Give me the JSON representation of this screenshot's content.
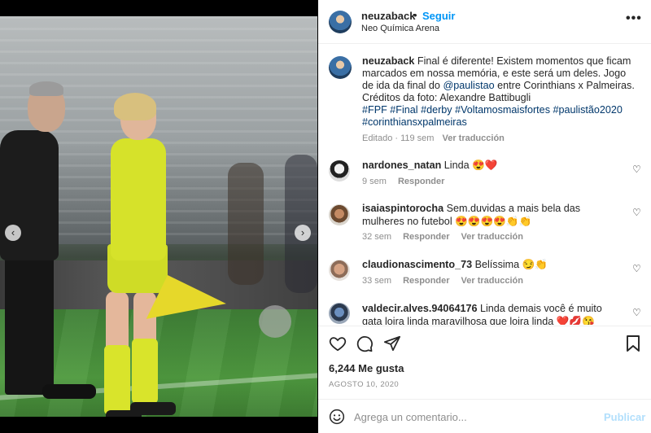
{
  "post": {
    "author": "neuzaback",
    "dot": "•",
    "follow_label": "Seguir",
    "location": "Neo Química Arena",
    "more_label": "•••"
  },
  "caption": {
    "author": "neuzaback",
    "text_1": "Final é diferente! Existem momentos que ficam marcados em nossa memória, e este será um deles. Jogo de ida da final do ",
    "mention": "@paulistao",
    "text_2": " entre Corinthians x Palmeiras. Créditos da foto: Alexandre Battibugli",
    "hashtags": "#FPF #Final #derby #Voltamosmaisfortes #paulistão2020 #corinthiansxpalmeiras",
    "edited": "Editado · 119 sem",
    "see_translation": "Ver traducción"
  },
  "comments": [
    {
      "user": "nardones_natan",
      "text": "Linda 😍❤️",
      "time": "9 sem",
      "reply": "Responder",
      "translate": ""
    },
    {
      "user": "isaiaspintorocha",
      "text": "Sem.duvidas a mais bela das mulheres no futebol 😍😍😍😍👏👏",
      "time": "32 sem",
      "reply": "Responder",
      "translate": "Ver traducción"
    },
    {
      "user": "claudionascimento_73",
      "text": "Belíssima 😏👏",
      "time": "33 sem",
      "reply": "Responder",
      "translate": "Ver traducción"
    },
    {
      "user": "valdecir.alves.94064176",
      "text": "Linda demais você é muito gata loira linda maravilhosa que loira linda ❤️💋😘",
      "time": "",
      "reply": "",
      "translate": ""
    }
  ],
  "stats": {
    "likes": "6,244 Me gusta",
    "date": "AGOSTO 10, 2020"
  },
  "composer": {
    "placeholder": "Agrega un comentario...",
    "publish": "Publicar"
  },
  "icons": {
    "prev": "‹",
    "next": "›",
    "heart_small": "♡"
  },
  "colors": {
    "accent": "#0095f6",
    "link": "#00376b",
    "muted": "#8e8e8e",
    "publish_disabled": "#b2dffc"
  }
}
